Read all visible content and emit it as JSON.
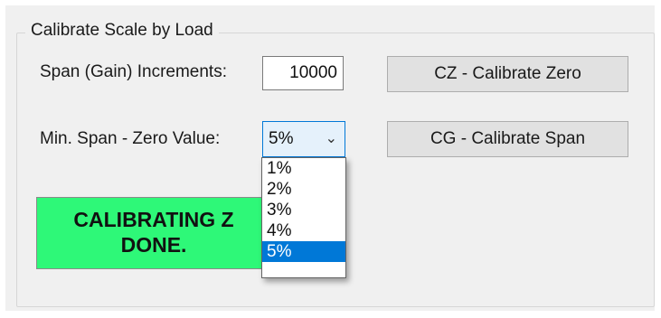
{
  "group": {
    "title": "Calibrate Scale by Load"
  },
  "span": {
    "label": "Span (Gain) Increments:",
    "value": "10000"
  },
  "min_span": {
    "label": "Min. Span - Zero Value:",
    "selected": "5%",
    "options": [
      "1%",
      "2%",
      "3%",
      "4%",
      "5%"
    ],
    "chevron_icon": "chevron-down"
  },
  "buttons": {
    "calibrate_zero": "CZ - Calibrate Zero",
    "calibrate_span": "CG - Calibrate Span"
  },
  "status": {
    "line1": "CALIBRATING Z",
    "line2": "DONE.",
    "color": "#2ef878"
  },
  "colors": {
    "selection": "#0078d7",
    "panel": "#f0f0f0"
  }
}
